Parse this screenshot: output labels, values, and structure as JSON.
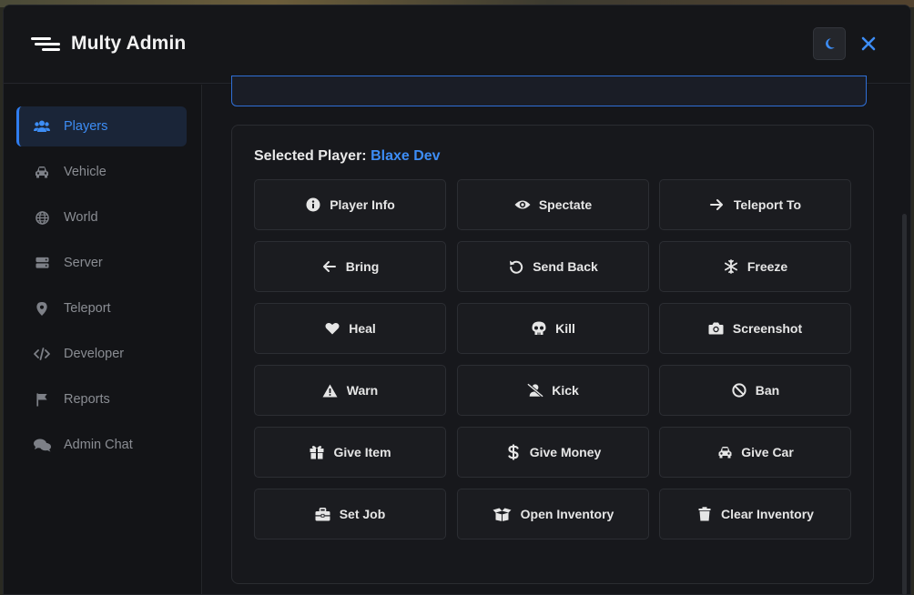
{
  "app": {
    "title": "Multy Admin",
    "accent_color": "#3d8df5",
    "menu_icon": "hamburger-menu-icon",
    "theme_icon": "moon-icon",
    "close_icon": "close-x-icon"
  },
  "sidebar": {
    "items": [
      {
        "label": "Players",
        "icon": "users-icon",
        "active": true
      },
      {
        "label": "Vehicle",
        "icon": "car-icon",
        "active": false
      },
      {
        "label": "World",
        "icon": "globe-icon",
        "active": false
      },
      {
        "label": "Server",
        "icon": "server-icon",
        "active": false
      },
      {
        "label": "Teleport",
        "icon": "map-pin-icon",
        "active": false
      },
      {
        "label": "Developer",
        "icon": "code-icon",
        "active": false
      },
      {
        "label": "Reports",
        "icon": "flag-icon",
        "active": false
      },
      {
        "label": "Admin Chat",
        "icon": "chat-bubbles-icon",
        "active": false
      }
    ]
  },
  "main": {
    "selected_label": "Selected Player:",
    "selected_player": "Blaxe Dev",
    "actions": [
      {
        "label": "Player Info",
        "icon": "info-circle-icon"
      },
      {
        "label": "Spectate",
        "icon": "eye-icon"
      },
      {
        "label": "Teleport To",
        "icon": "arrow-right-icon"
      },
      {
        "label": "Bring",
        "icon": "arrow-left-icon"
      },
      {
        "label": "Send Back",
        "icon": "undo-icon"
      },
      {
        "label": "Freeze",
        "icon": "snowflake-icon"
      },
      {
        "label": "Heal",
        "icon": "heart-icon"
      },
      {
        "label": "Kill",
        "icon": "skull-icon"
      },
      {
        "label": "Screenshot",
        "icon": "camera-icon"
      },
      {
        "label": "Warn",
        "icon": "warning-triangle-icon"
      },
      {
        "label": "Kick",
        "icon": "user-slash-icon"
      },
      {
        "label": "Ban",
        "icon": "ban-icon"
      },
      {
        "label": "Give Item",
        "icon": "gift-icon"
      },
      {
        "label": "Give Money",
        "icon": "dollar-icon"
      },
      {
        "label": "Give Car",
        "icon": "car-icon"
      },
      {
        "label": "Set Job",
        "icon": "briefcase-icon"
      },
      {
        "label": "Open Inventory",
        "icon": "open-box-icon"
      },
      {
        "label": "Clear Inventory",
        "icon": "trash-icon"
      }
    ]
  }
}
